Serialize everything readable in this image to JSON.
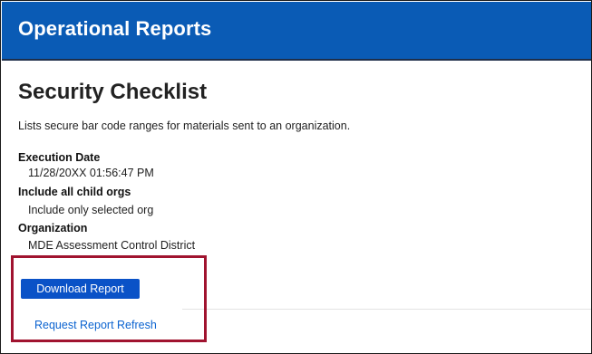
{
  "header": {
    "title": "Operational Reports",
    "color": "#0a5bb5"
  },
  "report": {
    "title": "Security Checklist",
    "description": "Lists secure bar code ranges for materials sent to an organization.",
    "fields": [
      {
        "label": "Execution Date",
        "value": "11/28/20XX 01:56:47 PM"
      },
      {
        "label": "Include all child orgs",
        "value": "Include only selected org"
      },
      {
        "label": "Organization",
        "value": "MDE Assessment Control District"
      }
    ]
  },
  "actions": {
    "download_label": "Download Report",
    "refresh_label": "Request Report Refresh",
    "download_color": "#0a52c7",
    "link_color": "#0b63d0",
    "highlight_color": "#a0132f"
  }
}
